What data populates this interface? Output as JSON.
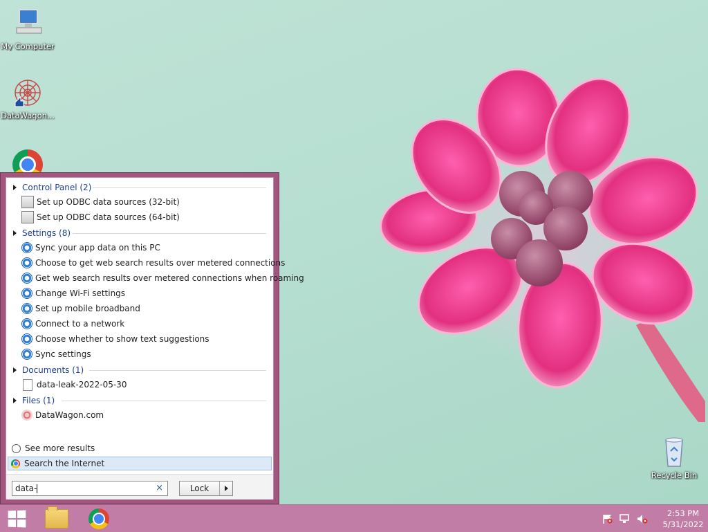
{
  "desktop": {
    "icons": [
      {
        "label": "My Computer"
      },
      {
        "label": "DataWagon..."
      },
      {
        "label": "Recycle Bin"
      }
    ]
  },
  "search_panel": {
    "groups": [
      {
        "label": "Control Panel (2)",
        "items": [
          "Set up ODBC data sources (32-bit)",
          "Set up ODBC data sources (64-bit)"
        ]
      },
      {
        "label": "Settings (8)",
        "items": [
          "Sync your app data on this PC",
          "Choose to get web search results over metered connections",
          "Get web search results over metered connections when roaming",
          "Change Wi-Fi settings",
          "Set up mobile broadband",
          "Connect to a network",
          "Choose whether to show text suggestions",
          "Sync settings"
        ]
      },
      {
        "label": "Documents (1)",
        "items": [
          "data-leak-2022-05-30"
        ]
      },
      {
        "label": "Files (1)",
        "items": [
          "DataWagon.com"
        ]
      }
    ],
    "see_more": "See more results",
    "search_internet": "Search the Internet",
    "query": "data-",
    "clear_glyph": "×",
    "lock_label": "Lock"
  },
  "taskbar": {
    "clock_time": "2:53 PM",
    "clock_date": "5/31/2022"
  },
  "icons": {
    "gear": "gear-icon",
    "odbc": "odbc-icon",
    "document": "document-icon",
    "website": "datawagon-icon"
  },
  "colors": {
    "menu_border": "#a2567f",
    "taskbar": "#c27da6",
    "group_heading": "#1e3e8c",
    "highlight": "#dde9f7"
  }
}
